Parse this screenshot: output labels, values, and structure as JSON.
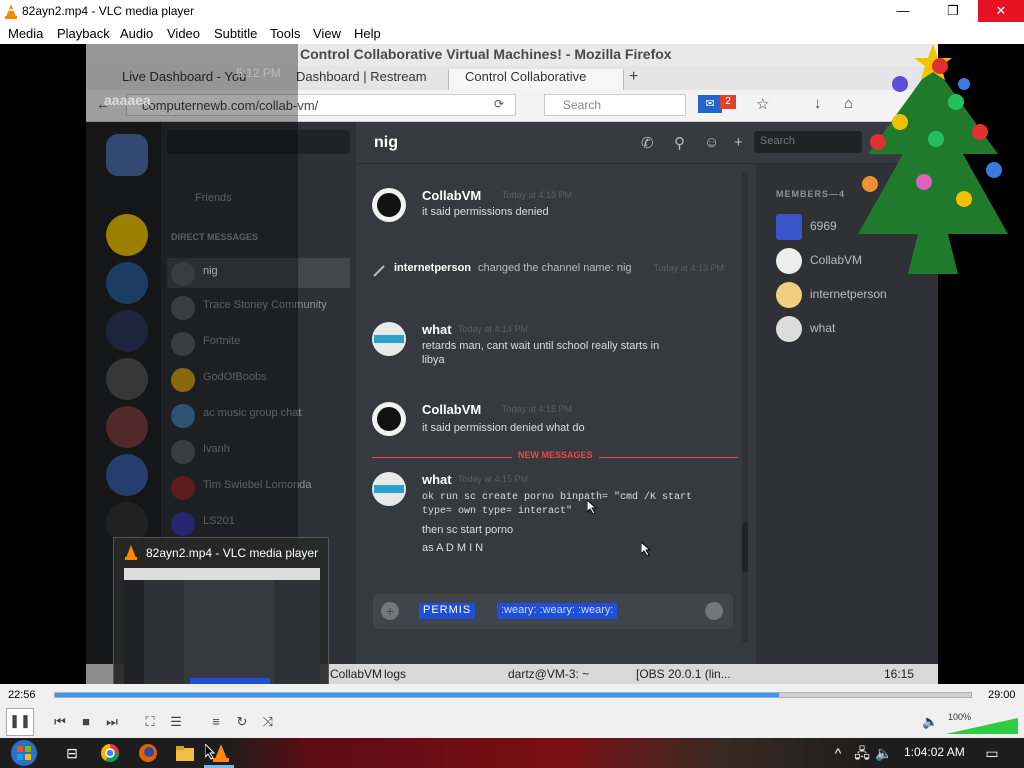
{
  "window": {
    "title": "82ayn2.mp4 - VLC media player",
    "menu": [
      "Media",
      "Playback",
      "Audio",
      "Video",
      "Subtitle",
      "Tools",
      "View",
      "Help"
    ],
    "minimize": "—",
    "maximize": "❐",
    "close": "✕"
  },
  "video": {
    "firefox_title": "Control Collaborative Virtual Machines! - Mozilla Firefox",
    "tabs": [
      "Live Dashboard - You",
      "Dashboard | Restream",
      "Control Collaborative"
    ],
    "url": "computernewb.com/collab-vm/",
    "search_placeholder": "Search",
    "mail_count": "2",
    "discord": {
      "channel_name": "nig",
      "header_search": "Search",
      "dm_label": "Friends",
      "dm_section": "DIRECT MESSAGES",
      "dms": [
        "nig",
        "Trace Stoney Community",
        "Fortnite",
        "GodOfBoobs",
        "ac music group chat",
        "Ivanh",
        "Tim Swiebel Lomonda",
        "LS201"
      ],
      "messages": [
        {
          "author": "CollabVM",
          "timestamp": "Today at 4:13 PM",
          "text": "it said permissions denied"
        },
        {
          "author": "what",
          "timestamp": "Today at 4:14 PM",
          "text": "retards man, cant wait until school really starts in",
          "text2": "libya"
        },
        {
          "author": "CollabVM",
          "timestamp": "Today at 4:15 PM",
          "text": "it said permission denied what do"
        },
        {
          "author": "what",
          "timestamp": "Today at 4:15 PM",
          "text": "ok run sc create porno  binpath= \"cmd /K start",
          "text2": "type= own type= interact\"",
          "text3": "then sc start porno",
          "text4": "as A D M I N"
        }
      ],
      "system_message": {
        "user": "internetperson",
        "action": "changed the channel name: nig",
        "time": "Today at 4:13 PM"
      },
      "new_messages_label": "NEW MESSAGES",
      "composer_selected": "PERMIS",
      "composer_selected2": ":weary: :weary: :weary:",
      "members_header": "MEMBERS—4",
      "members": [
        "6969",
        "CollabVM",
        "internetperson",
        "what"
      ]
    },
    "inner_taskbar": {
      "item1": "CollabVM",
      "item2": "logs",
      "item3": "dartz@VM-3: ~",
      "item4": "[OBS 20.0.1 (lin...",
      "clock": "16:15"
    },
    "tooltip_time": "5:12 PM",
    "tooltip_tag": "aaaaea"
  },
  "preview": {
    "title": "82ayn2.mp4 - VLC media player",
    "pause_icon": "⏸"
  },
  "player": {
    "current_time": "22:56",
    "total_time": "29:00",
    "progress": 0.79,
    "volume_label": "100%",
    "volume": 1.0
  },
  "taskbar": {
    "time": "1:04:02 AM"
  }
}
